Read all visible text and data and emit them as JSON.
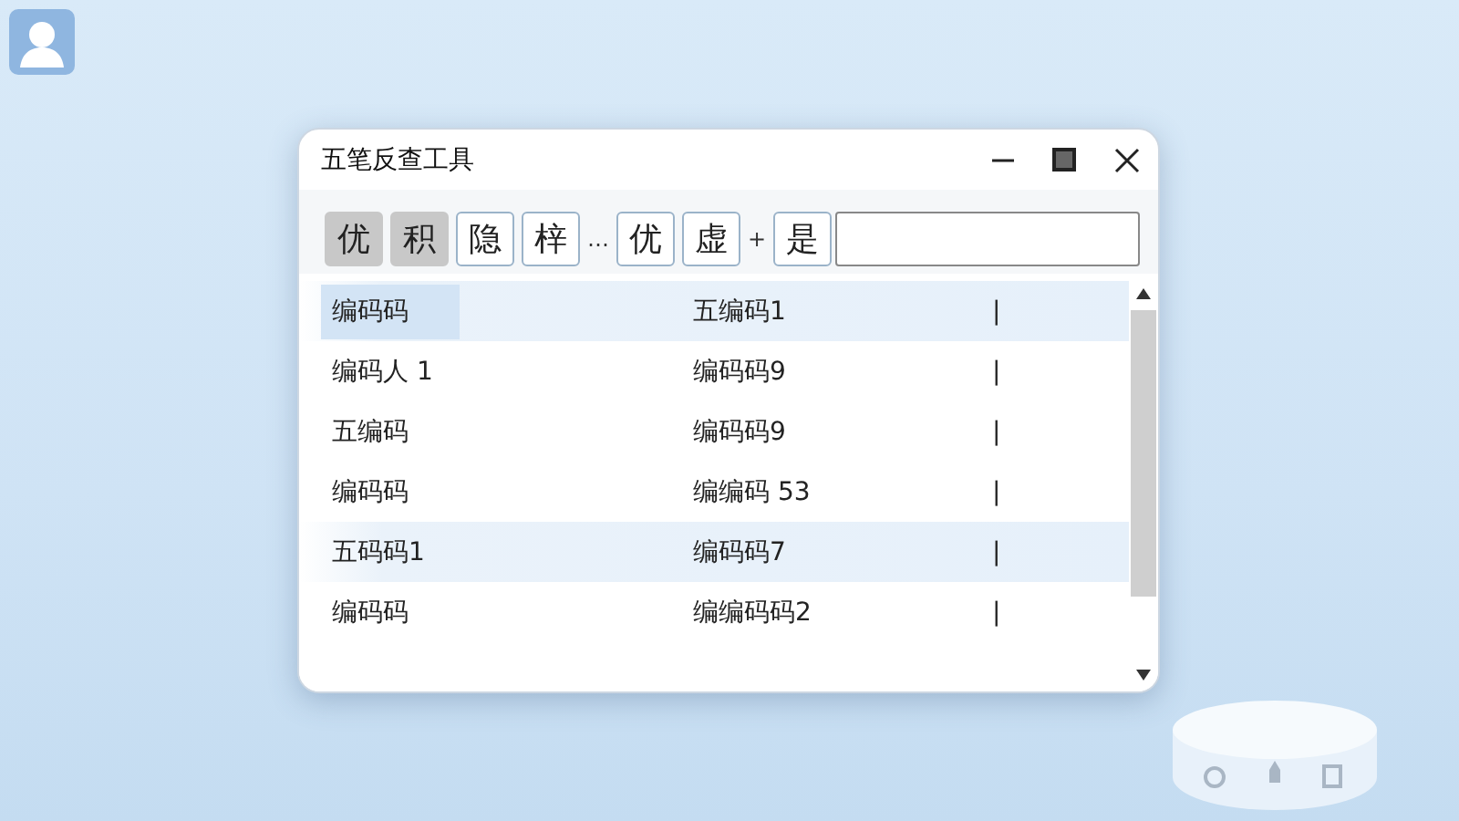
{
  "window": {
    "title": "五笔反查工具"
  },
  "toolbar": [
    {
      "kind": "char",
      "label": "优",
      "selected": true
    },
    {
      "kind": "char",
      "label": "积",
      "selected": true
    },
    {
      "kind": "char",
      "label": "隐",
      "selected": false
    },
    {
      "kind": "char",
      "label": "梓",
      "selected": false
    },
    {
      "kind": "sep",
      "label": "…"
    },
    {
      "kind": "char",
      "label": "优",
      "selected": false
    },
    {
      "kind": "char",
      "label": "虚",
      "selected": false
    },
    {
      "kind": "sep",
      "label": "+"
    },
    {
      "kind": "char",
      "label": "是",
      "selected": false
    }
  ],
  "rows": [
    {
      "left": "编码码",
      "left_selected": true,
      "highlighted": true,
      "right": "五编码1",
      "mark": "|"
    },
    {
      "left": "编码人 1",
      "left_selected": false,
      "highlighted": false,
      "right": "编码码9",
      "mark": "|"
    },
    {
      "left": "五编码",
      "left_selected": false,
      "highlighted": false,
      "right": "编码码9",
      "mark": "|"
    },
    {
      "left": "编码码",
      "left_selected": false,
      "highlighted": false,
      "right": "编编码 53",
      "mark": "|"
    },
    {
      "left": "五码码1",
      "left_selected": false,
      "highlighted": true,
      "right": "编码码7",
      "mark": "|"
    },
    {
      "left": "编码码",
      "left_selected": false,
      "highlighted": false,
      "right": "编编码码2",
      "mark": "|"
    }
  ]
}
